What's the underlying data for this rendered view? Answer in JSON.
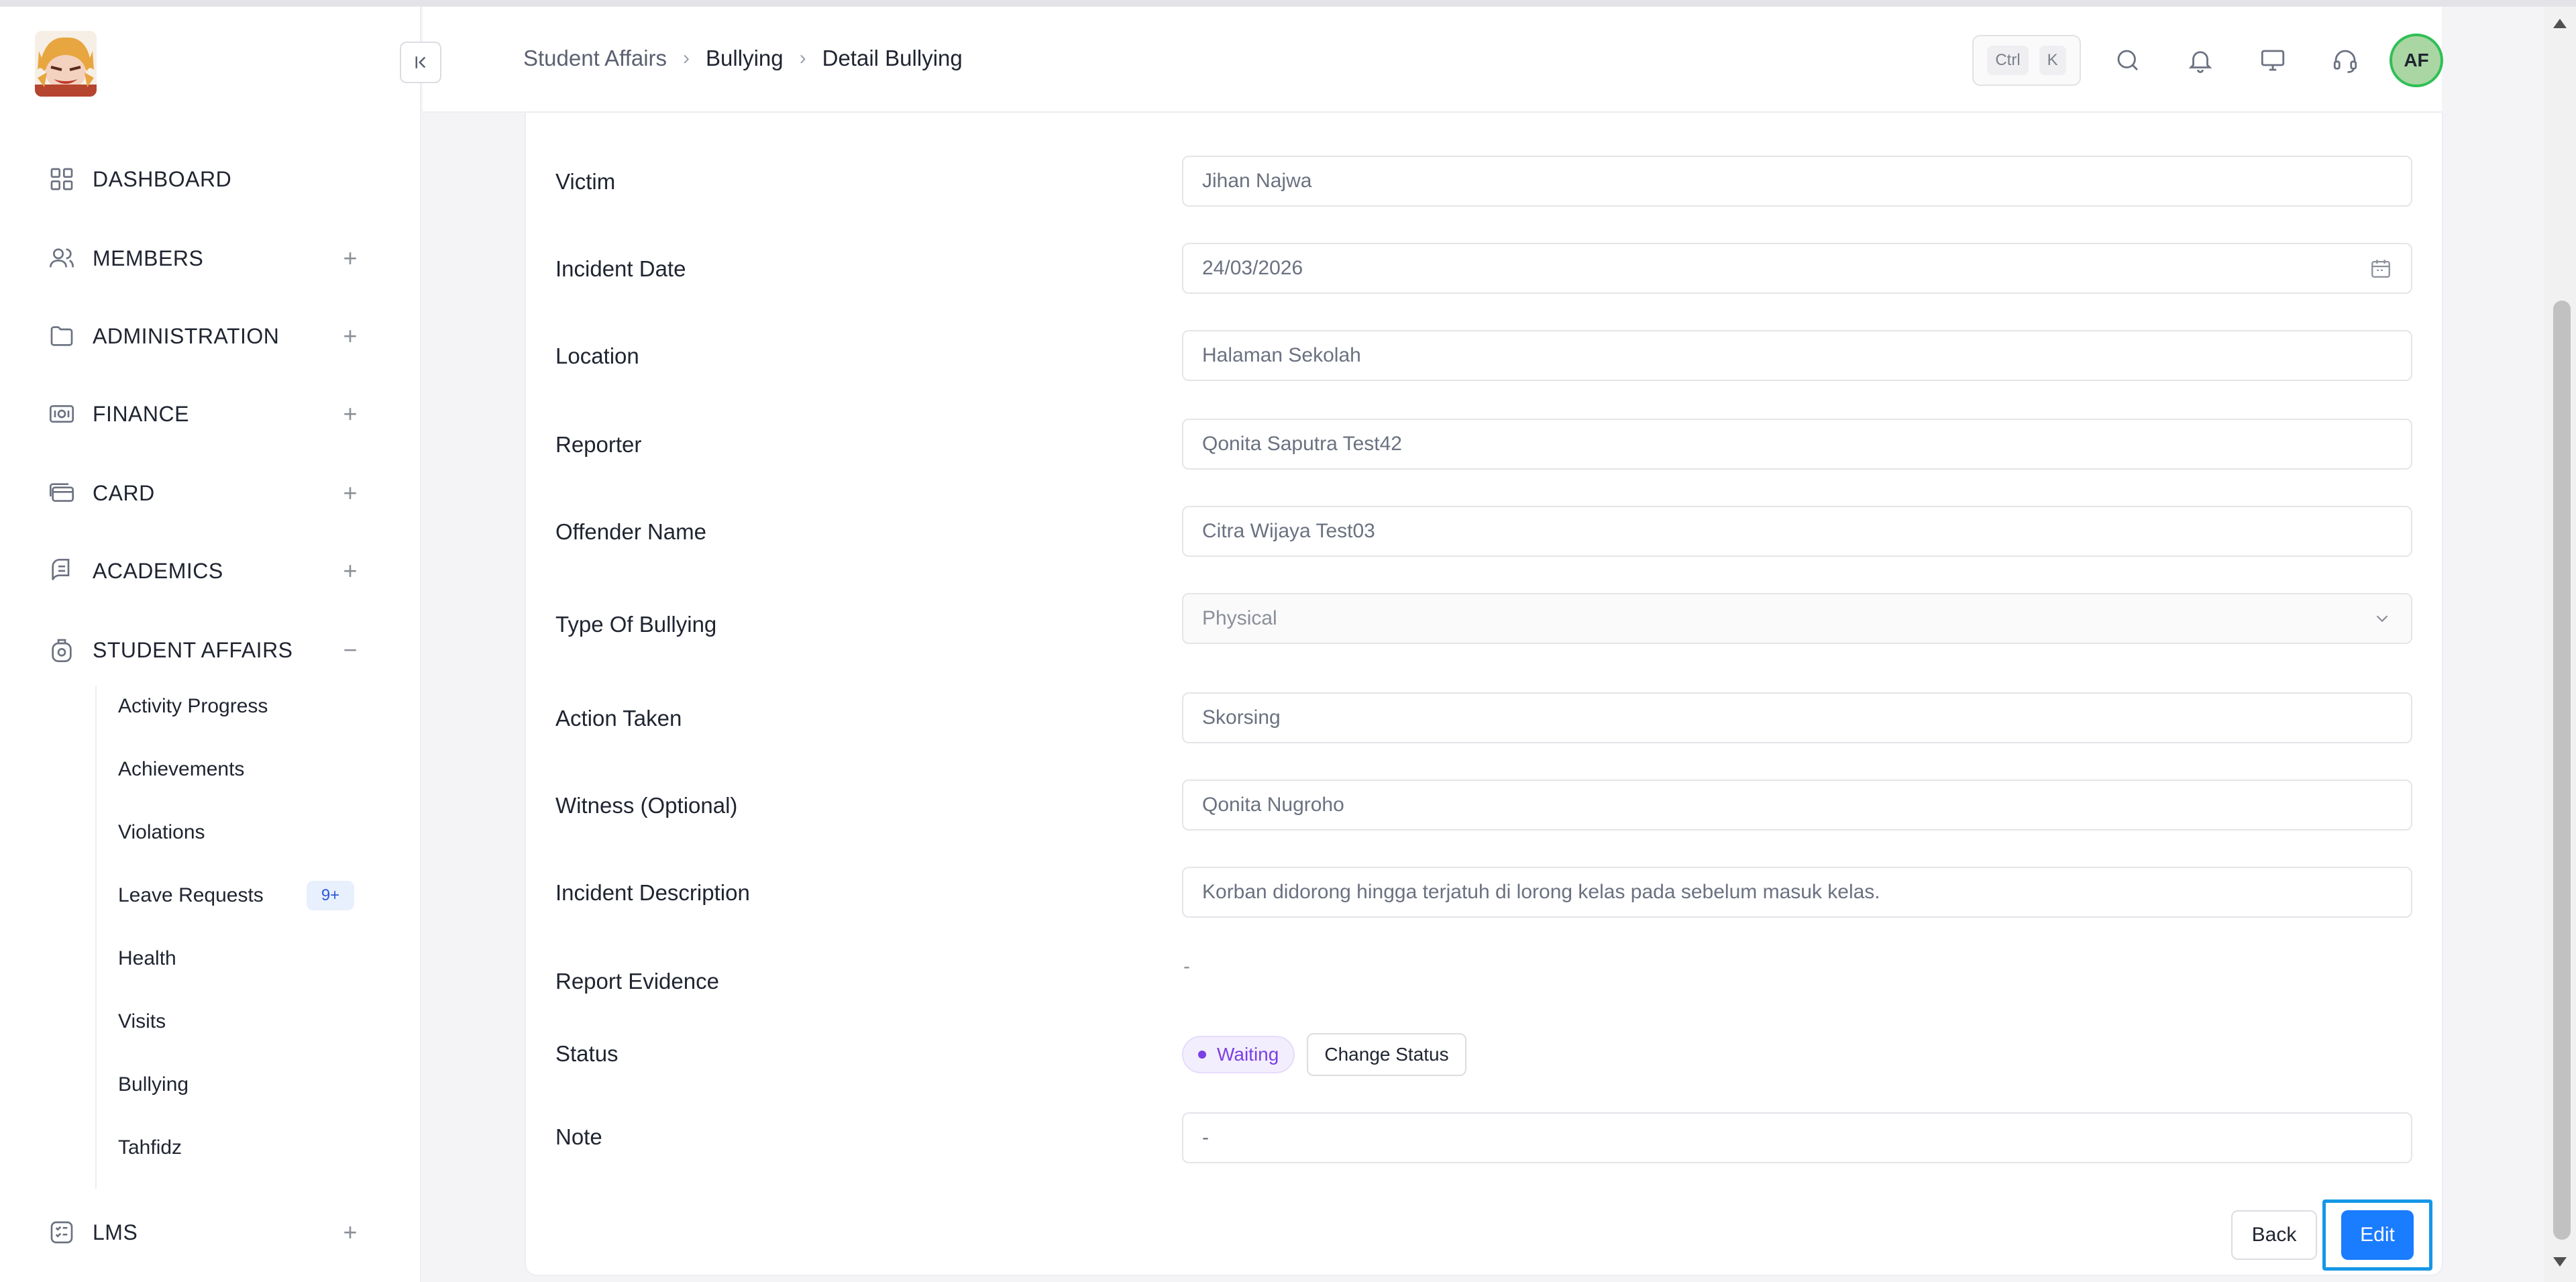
{
  "sidebar": {
    "logo": "app-logo",
    "nav": [
      {
        "label": "DASHBOARD",
        "icon": "grid-icon",
        "toggle": ""
      },
      {
        "label": "MEMBERS",
        "icon": "users-icon",
        "toggle": "+"
      },
      {
        "label": "ADMINISTRATION",
        "icon": "folder-icon",
        "toggle": "+"
      },
      {
        "label": "FINANCE",
        "icon": "money-icon",
        "toggle": "+"
      },
      {
        "label": "CARD",
        "icon": "card-icon",
        "toggle": "+"
      },
      {
        "label": "ACADEMICS",
        "icon": "book-icon",
        "toggle": "+"
      },
      {
        "label": "STUDENT AFFAIRS",
        "icon": "student-icon",
        "toggle": "−"
      },
      {
        "label": "LMS",
        "icon": "checklist-icon",
        "toggle": "+"
      }
    ],
    "student_affairs_items": [
      {
        "label": "Activity Progress"
      },
      {
        "label": "Achievements"
      },
      {
        "label": "Violations"
      },
      {
        "label": "Leave Requests",
        "badge": "9+"
      },
      {
        "label": "Health"
      },
      {
        "label": "Visits"
      },
      {
        "label": "Bullying"
      },
      {
        "label": "Tahfidz"
      }
    ]
  },
  "header": {
    "breadcrumb": [
      "Student Affairs",
      "Bullying",
      "Detail Bullying"
    ],
    "shortcut_keys": [
      "Ctrl",
      "K"
    ],
    "avatar_initials": "AF"
  },
  "form": {
    "victim_label": "Victim",
    "victim_value": "Jihan Najwa",
    "incident_date_label": "Incident Date",
    "incident_date_value": "24/03/2026",
    "location_label": "Location",
    "location_value": "Halaman Sekolah",
    "reporter_label": "Reporter",
    "reporter_value": "Qonita Saputra Test42",
    "offender_label": "Offender Name",
    "offender_value": "Citra Wijaya Test03",
    "type_label": "Type Of Bullying",
    "type_value": "Physical",
    "action_label": "Action Taken",
    "action_value": "Skorsing",
    "witness_label": "Witness (Optional)",
    "witness_value": "Qonita Nugroho",
    "description_label": "Incident Description",
    "description_value": "Korban didorong hingga terjatuh di lorong kelas pada sebelum masuk kelas.",
    "evidence_label": "Report Evidence",
    "evidence_value": "-",
    "status_label": "Status",
    "status_value": "Waiting",
    "change_status_label": "Change Status",
    "note_label": "Note",
    "note_value": "-"
  },
  "actions": {
    "back_label": "Back",
    "edit_label": "Edit"
  },
  "colors": {
    "primary": "#1a7cff",
    "status_waiting": "#7b3fe4",
    "avatar_border": "#2fbf55",
    "focus_ring": "#1597e8"
  }
}
